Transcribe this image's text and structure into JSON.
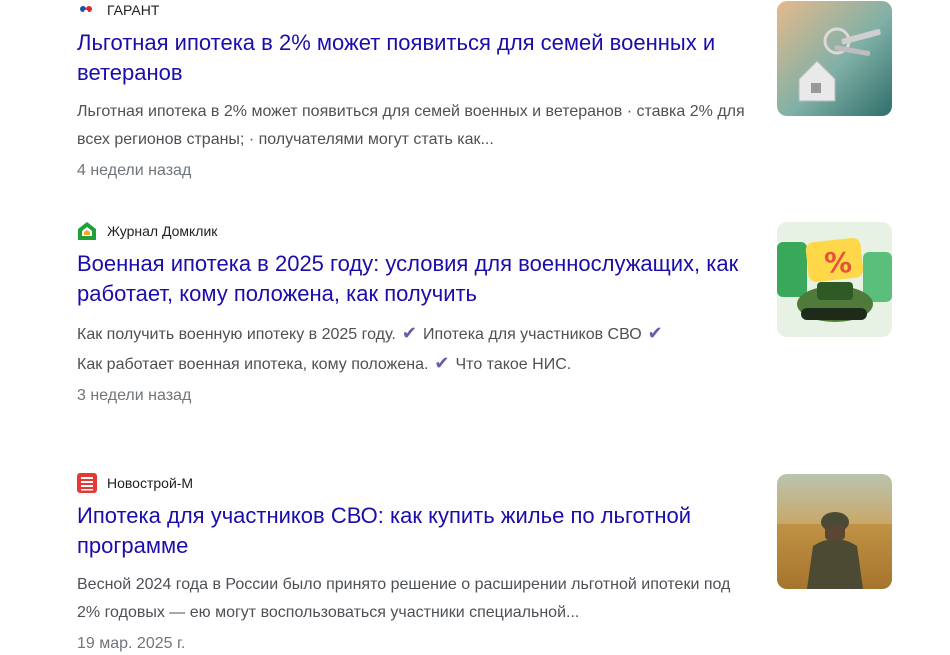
{
  "results": [
    {
      "source": "ГАРАНТ",
      "title": "Льготная ипотека в 2% может появиться для семей военных и ветеранов",
      "snippet": "Льготная ипотека в 2% может появиться для семей военных и ветеранов · ставка 2% для всех регионов страны; · получателями могут стать как...",
      "date": "4 недели назад",
      "favicon_icon": "garant-logo-icon",
      "thumbnail": "keys-house-image"
    },
    {
      "source": "Журнал Домклик",
      "title": "Военная ипотека в 2025 году: условия для военнослужащих, как работает, кому положена, как получить",
      "snippet_parts": [
        "Как получить военную ипотеку в 2025 году.",
        "Ипотека для участников СВО",
        "Как работает военная ипотека, кому положена.",
        "Что такое НИС."
      ],
      "check_glyph": "✔",
      "date": "3 недели назад",
      "favicon_icon": "domclick-logo-icon",
      "thumbnail": "military-cap-percent-image"
    },
    {
      "source": "Новострой-М",
      "title": "Ипотека для участников СВО: как купить жилье по льготной программе",
      "snippet": "Весной 2024 года в России было принято решение о расширении льготной ипотеки под 2% годовых — ею могут воспользоваться участники специальной...",
      "date": "19 мар. 2025 г.",
      "favicon_icon": "novostroy-logo-icon",
      "thumbnail": "soldier-field-image"
    }
  ],
  "colors": {
    "title": "#1a0dab",
    "check": "#6b5aa8",
    "text": "#4d5156",
    "date": "#70757a"
  }
}
